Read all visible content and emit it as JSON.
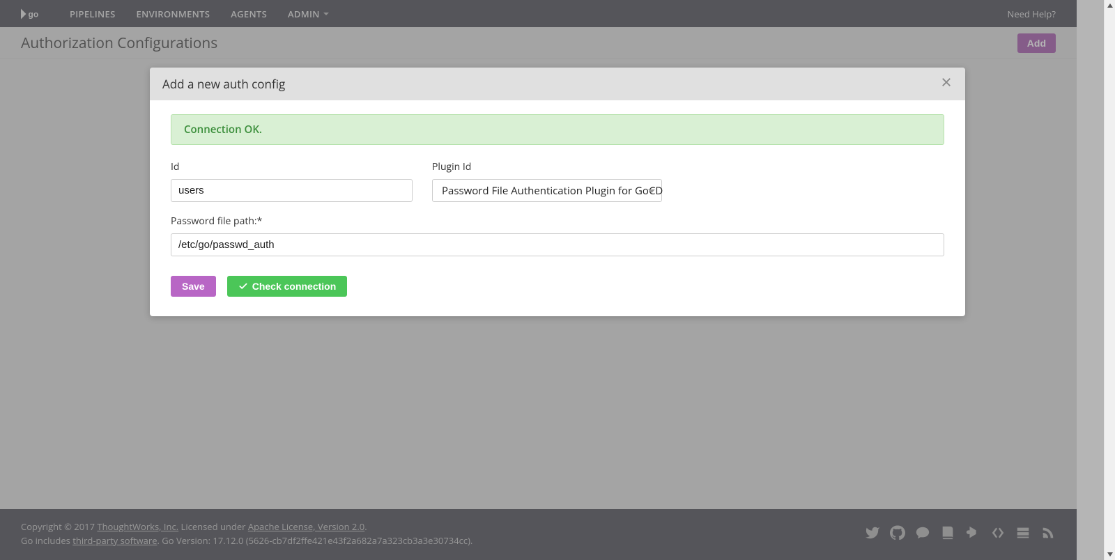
{
  "nav": {
    "items": [
      "PIPELINES",
      "ENVIRONMENTS",
      "AGENTS",
      "ADMIN"
    ],
    "help": "Need Help?"
  },
  "subheader": {
    "title": "Authorization Configurations",
    "add_label": "Add"
  },
  "modal": {
    "title": "Add a new auth config",
    "alert": "Connection OK.",
    "id_label": "Id",
    "id_value": "users",
    "plugin_label": "Plugin Id",
    "plugin_value": "Password File Authentication Plugin for GoCD",
    "path_label": "Password file path:*",
    "path_value": "/etc/go/passwd_auth",
    "save_label": "Save",
    "check_label": "Check connection"
  },
  "footer": {
    "copyright_prefix": "Copyright © 2017 ",
    "thoughtworks": "ThoughtWorks, Inc.",
    "licensed": " Licensed under ",
    "license_link": "Apache License, Version 2.0",
    "period": ".",
    "includes_prefix": "Go includes ",
    "third_party": "third-party software",
    "version_suffix": ". Go Version: 17.12.0 (5626-cb7df2ffe421e43f2a682a7a323cb3a3e30734cc)."
  }
}
